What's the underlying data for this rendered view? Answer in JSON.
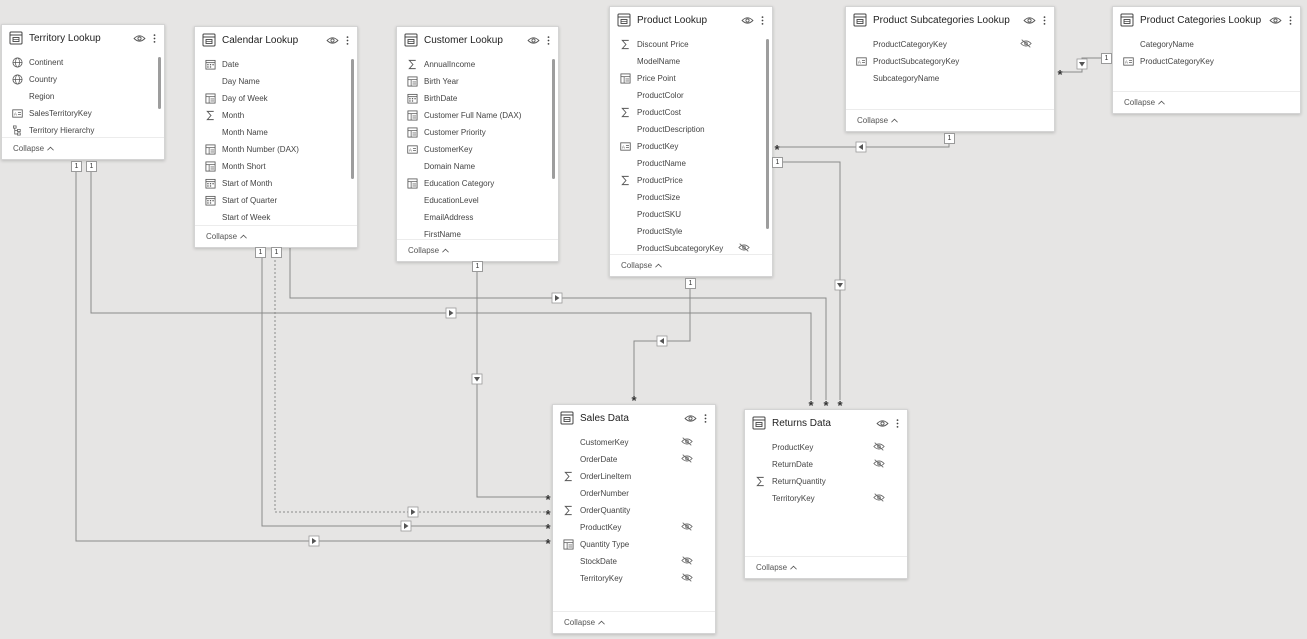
{
  "tables": [
    {
      "id": "territory-lookup",
      "title": "Territory Lookup",
      "collapse_label": "Collapse",
      "fields": [
        {
          "name": "Continent",
          "icon": "globe-icon"
        },
        {
          "name": "Country",
          "icon": "globe-icon"
        },
        {
          "name": "Region",
          "icon": ""
        },
        {
          "name": "SalesTerritoryKey",
          "icon": "text-field-icon"
        },
        {
          "name": "Territory Hierarchy",
          "icon": "hierarchy-icon"
        }
      ]
    },
    {
      "id": "calendar-lookup",
      "title": "Calendar Lookup",
      "collapse_label": "Collapse",
      "fields": [
        {
          "name": "Date",
          "icon": "calendar-icon"
        },
        {
          "name": "Day Name",
          "icon": ""
        },
        {
          "name": "Day of Week",
          "icon": "calculated-column-icon"
        },
        {
          "name": "Month",
          "icon": "sigma-icon"
        },
        {
          "name": "Month Name",
          "icon": ""
        },
        {
          "name": "Month Number (DAX)",
          "icon": "calculated-column-icon"
        },
        {
          "name": "Month Short",
          "icon": "calculated-column-icon"
        },
        {
          "name": "Start of Month",
          "icon": "calendar-icon"
        },
        {
          "name": "Start of Quarter",
          "icon": "calendar-icon"
        },
        {
          "name": "Start of Week",
          "icon": ""
        }
      ]
    },
    {
      "id": "customer-lookup",
      "title": "Customer Lookup",
      "collapse_label": "Collapse",
      "fields": [
        {
          "name": "AnnualIncome",
          "icon": "sigma-icon"
        },
        {
          "name": "Birth Year",
          "icon": "calculated-column-icon"
        },
        {
          "name": "BirthDate",
          "icon": "calendar-icon"
        },
        {
          "name": "Customer Full Name (DAX)",
          "icon": "calculated-column-icon"
        },
        {
          "name": "Customer Priority",
          "icon": "calculated-column-icon"
        },
        {
          "name": "CustomerKey",
          "icon": "text-field-icon"
        },
        {
          "name": "Domain Name",
          "icon": ""
        },
        {
          "name": "Education Category",
          "icon": "calculated-column-icon"
        },
        {
          "name": "EducationLevel",
          "icon": ""
        },
        {
          "name": "EmailAddress",
          "icon": ""
        },
        {
          "name": "FirstName",
          "icon": ""
        }
      ]
    },
    {
      "id": "product-lookup",
      "title": "Product Lookup",
      "collapse_label": "Collapse",
      "fields": [
        {
          "name": "Discount Price",
          "icon": "sigma-icon"
        },
        {
          "name": "ModelName",
          "icon": ""
        },
        {
          "name": "Price Point",
          "icon": "calculated-column-icon"
        },
        {
          "name": "ProductColor",
          "icon": ""
        },
        {
          "name": "ProductCost",
          "icon": "sigma-icon"
        },
        {
          "name": "ProductDescription",
          "icon": ""
        },
        {
          "name": "ProductKey",
          "icon": "text-field-icon"
        },
        {
          "name": "ProductName",
          "icon": ""
        },
        {
          "name": "ProductPrice",
          "icon": "sigma-icon"
        },
        {
          "name": "ProductSize",
          "icon": ""
        },
        {
          "name": "ProductSKU",
          "icon": ""
        },
        {
          "name": "ProductStyle",
          "icon": ""
        },
        {
          "name": "ProductSubcategoryKey",
          "icon": "",
          "hidden": true
        }
      ]
    },
    {
      "id": "product-subcategories-lookup",
      "title": "Product Subcategories Lookup",
      "collapse_label": "Collapse",
      "fields": [
        {
          "name": "ProductCategoryKey",
          "icon": "",
          "hidden": true
        },
        {
          "name": "ProductSubcategoryKey",
          "icon": "text-field-icon"
        },
        {
          "name": "SubcategoryName",
          "icon": ""
        }
      ]
    },
    {
      "id": "product-categories-lookup",
      "title": "Product Categories Lookup",
      "collapse_label": "Collapse",
      "fields": [
        {
          "name": "CategoryName",
          "icon": ""
        },
        {
          "name": "ProductCategoryKey",
          "icon": "text-field-icon"
        }
      ]
    },
    {
      "id": "sales-data",
      "title": "Sales Data",
      "collapse_label": "Collapse",
      "fields": [
        {
          "name": "CustomerKey",
          "icon": "",
          "hidden": true
        },
        {
          "name": "OrderDate",
          "icon": "",
          "hidden": true
        },
        {
          "name": "OrderLineItem",
          "icon": "sigma-icon"
        },
        {
          "name": "OrderNumber",
          "icon": ""
        },
        {
          "name": "OrderQuantity",
          "icon": "sigma-icon"
        },
        {
          "name": "ProductKey",
          "icon": "",
          "hidden": true
        },
        {
          "name": "Quantity Type",
          "icon": "calculated-column-icon"
        },
        {
          "name": "StockDate",
          "icon": "",
          "hidden": true
        },
        {
          "name": "TerritoryKey",
          "icon": "",
          "hidden": true
        }
      ]
    },
    {
      "id": "returns-data",
      "title": "Returns Data",
      "collapse_label": "Collapse",
      "fields": [
        {
          "name": "ProductKey",
          "icon": "",
          "hidden": true
        },
        {
          "name": "ReturnDate",
          "icon": "",
          "hidden": true
        },
        {
          "name": "ReturnQuantity",
          "icon": "sigma-icon"
        },
        {
          "name": "TerritoryKey",
          "icon": "",
          "hidden": true
        }
      ]
    }
  ],
  "cardinality": {
    "one": "1",
    "many": "*"
  },
  "colors": {
    "line": "#8a8a8a",
    "canvas": "#e6e5e4",
    "card": "#ffffff",
    "icon": "#555555"
  }
}
